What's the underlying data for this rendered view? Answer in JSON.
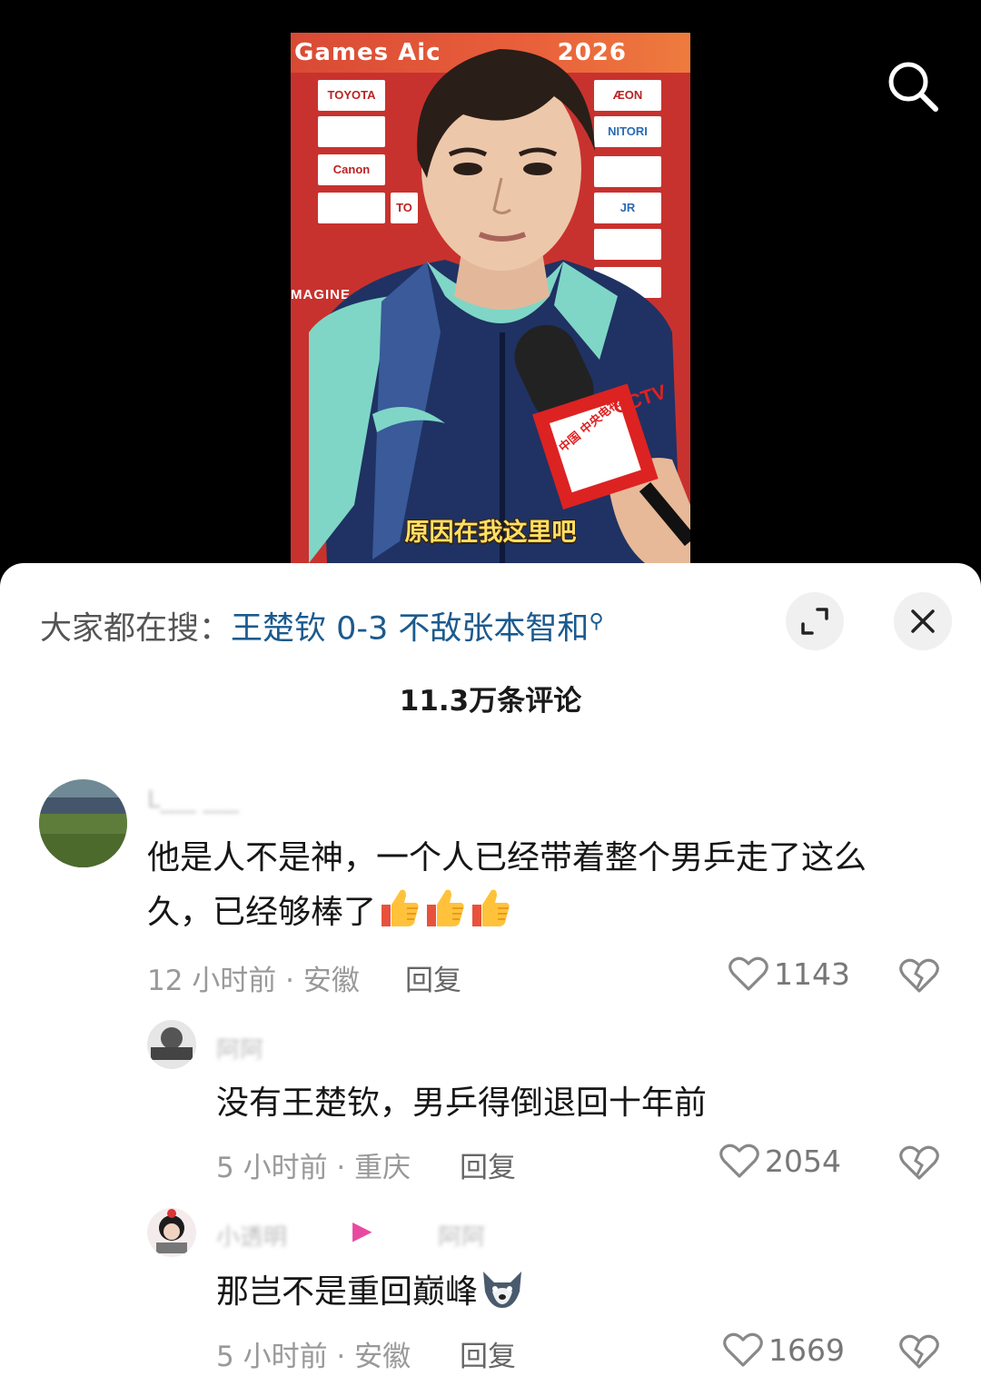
{
  "video": {
    "backdrop_title": "Games Aic",
    "backdrop_year": "2026",
    "tagline": "MAGINE ONE ASIA",
    "sponsors": [
      "TOYOTA",
      "ÆON",
      "Canon",
      "NITORI",
      "JR",
      "TO"
    ],
    "mic_flag_text": "CCTV",
    "mic_cube_text": "中国 中央电视台",
    "caption": "原因在我这里吧"
  },
  "sheet": {
    "search_prefix": "大家都在搜：",
    "search_query": "王楚钦 0-3 不敌张本智和",
    "comment_count": "11.3万条评论"
  },
  "comments": [
    {
      "username": "L___ ___",
      "text_line1": "他是人不是神，一个人已经带着整个男乒走了这么",
      "text_line2": "久，已经够棒了",
      "meta": "12 小时前 · 安徽",
      "reply_label": "回复",
      "likes": "1143"
    },
    {
      "username": "阿阿_ _",
      "text_line1": "没有王楚钦，男乒得倒退回十年前",
      "meta": "5 小时前 · 重庆",
      "reply_label": "回复",
      "likes": "2054"
    },
    {
      "username": "小透明",
      "reply_to": "阿阿_",
      "text_line1": "那岂不是重回巅峰",
      "meta": "5 小时前 · 安徽",
      "reply_label": "回复",
      "likes": "1669"
    }
  ],
  "colors": {
    "accent_link": "#1b5a8e",
    "backdrop_red": "#c8322e",
    "caption_yellow": "#ffe066"
  },
  "icons": [
    "search-icon",
    "expand-icon",
    "close-icon",
    "heart-icon",
    "broken-heart-icon",
    "thumbs-up-emoji",
    "wolf-emoji"
  ]
}
